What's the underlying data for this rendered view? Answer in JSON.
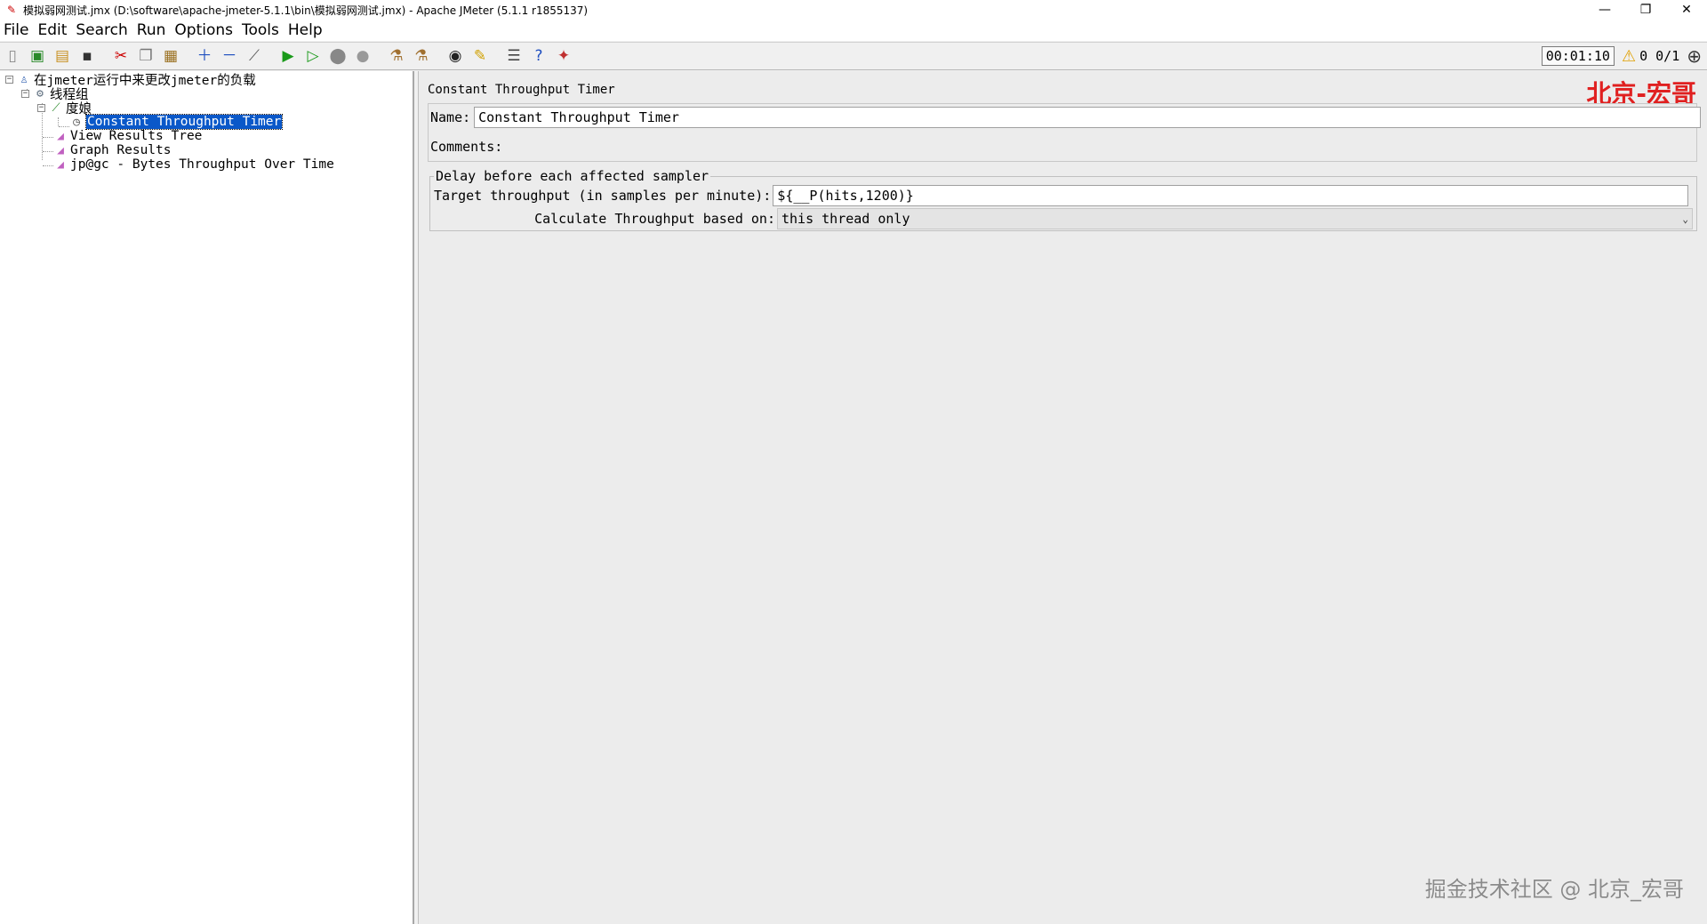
{
  "window": {
    "title": "模拟弱网测试.jmx (D:\\software\\apache-jmeter-5.1.1\\bin\\模拟弱网测试.jmx) - Apache JMeter (5.1.1 r1855137)",
    "minimize": "—",
    "restore": "❐",
    "close": "✕"
  },
  "menu": [
    "File",
    "Edit",
    "Search",
    "Run",
    "Options",
    "Tools",
    "Help"
  ],
  "toolbar": {
    "timer": "00:01:10",
    "counts": "0 0/1"
  },
  "tree": {
    "root": "在jmeter运行中来更改jmeter的负载",
    "thread_group": "线程组",
    "sampler": "度娘",
    "timer": "Constant Throughput Timer",
    "listener1": "View Results Tree",
    "listener2": "Graph Results",
    "listener3": "jp@gc - Bytes Throughput Over Time"
  },
  "panel": {
    "title": "Constant Throughput Timer",
    "watermark_top": "北京-宏哥",
    "name_label": "Name:",
    "name_value": "Constant Throughput Timer",
    "comments_label": "Comments:",
    "comments_value": "",
    "group_title": "Delay before each affected sampler",
    "target_label": "Target throughput (in samples per minute):",
    "target_value": "${__P(hits,1200)}",
    "calc_label": "Calculate Throughput based on:",
    "calc_value": "this thread only"
  },
  "watermark_bottom": "掘金技术社区 @ 北京_宏哥"
}
